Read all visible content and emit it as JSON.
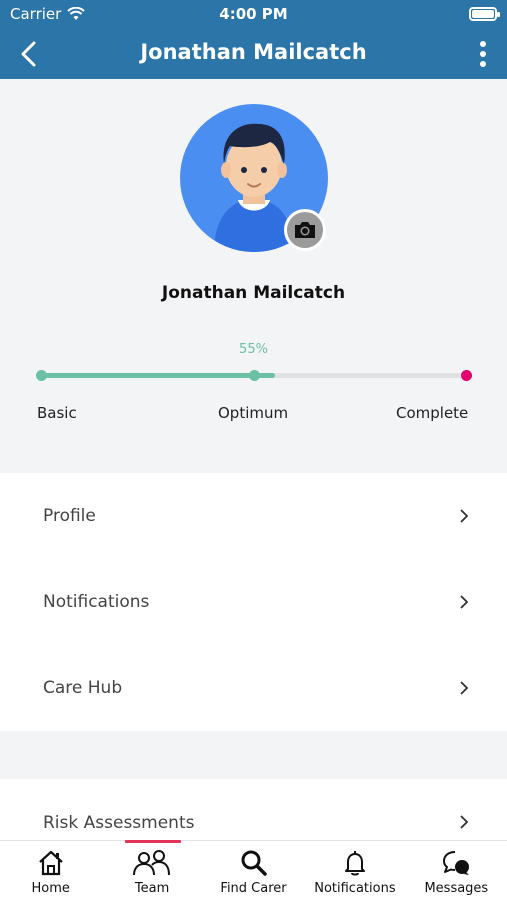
{
  "status": {
    "carrier": "Carrier",
    "time": "4:00 PM"
  },
  "header": {
    "title": "Jonathan Mailcatch"
  },
  "profile": {
    "name": "Jonathan Mailcatch"
  },
  "progress": {
    "percent_label": "55%",
    "value": 0.55,
    "labels": [
      "Basic",
      "Optimum",
      "Complete"
    ],
    "colors": {
      "fill": "#6cc0a3",
      "end": "#e1006e"
    }
  },
  "menu": {
    "group1": [
      {
        "label": "Profile"
      },
      {
        "label": "Notifications"
      },
      {
        "label": "Care Hub"
      }
    ],
    "group2": [
      {
        "label": "Risk Assessments"
      }
    ]
  },
  "bottom_nav": [
    {
      "label": "Home",
      "icon": "home-icon"
    },
    {
      "label": "Team",
      "icon": "team-icon",
      "active": true
    },
    {
      "label": "Find Carer",
      "icon": "search-icon"
    },
    {
      "label": "Notifications",
      "icon": "bell-icon"
    },
    {
      "label": "Messages",
      "icon": "chat-icon"
    }
  ],
  "colors": {
    "header": "#2b75a9",
    "accent": "#e4345a",
    "avatar_bg": "#4b8ef2"
  }
}
